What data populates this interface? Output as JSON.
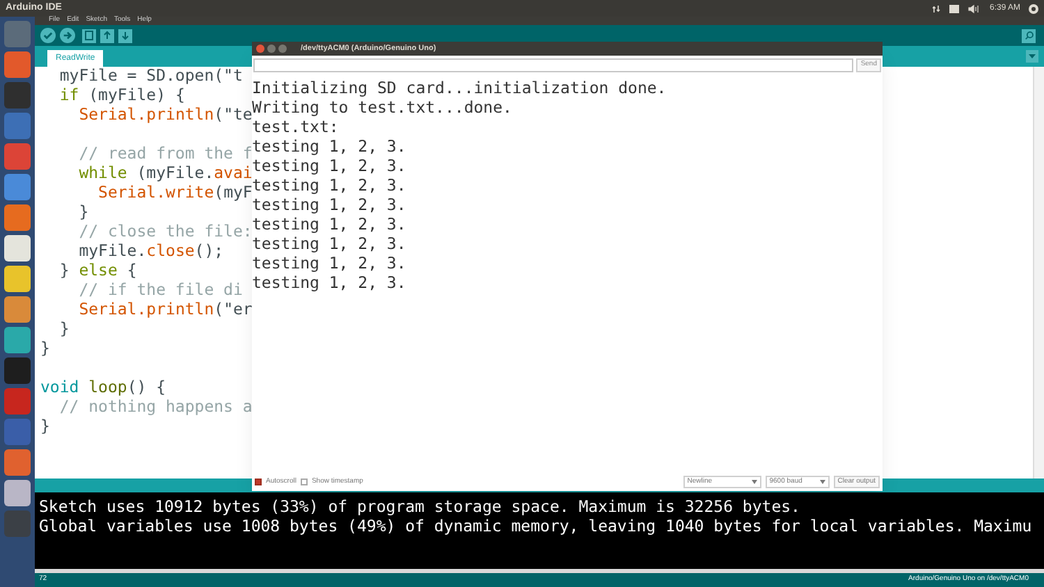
{
  "top_bar": {
    "title": "Arduino IDE",
    "time": "6:39 AM"
  },
  "launcher": {
    "items": [
      {
        "color": "#5b6b7a"
      },
      {
        "color": "#e2592b"
      },
      {
        "color": "#2f2f2f"
      },
      {
        "color": "#3d6fb5"
      },
      {
        "color": "#dc4437"
      },
      {
        "color": "#4a8ad8"
      },
      {
        "color": "#e66b1f"
      },
      {
        "color": "#e4e4dc"
      },
      {
        "color": "#e8c32b"
      },
      {
        "color": "#d98a3a"
      },
      {
        "color": "#2aa9a9"
      },
      {
        "color": "#1e1e1e"
      },
      {
        "color": "#c7261e"
      },
      {
        "color": "#3a5ea8"
      },
      {
        "color": "#e0612f"
      },
      {
        "color": "#b9b6c6"
      },
      {
        "color": "#3b4046"
      }
    ]
  },
  "menu": [
    "File",
    "Edit",
    "Sketch",
    "Tools",
    "Help"
  ],
  "tabs": [
    {
      "label": "ReadWrite",
      "selected": true
    }
  ],
  "editor": {
    "lines": [
      {
        "kind": "code",
        "segments": [
          {
            "text": "  myFile = SD.open(\"t",
            "kind": "plain"
          }
        ]
      },
      {
        "kind": "code",
        "segments": [
          {
            "text": "  if",
            "kind": "keyword"
          },
          {
            "text": " (myFile) {",
            "kind": "plain"
          }
        ]
      },
      {
        "kind": "code",
        "segments": [
          {
            "text": "    Serial",
            "kind": "class"
          },
          {
            "text": ".println",
            "kind": "function"
          },
          {
            "text": "(\"te",
            "kind": "plain"
          }
        ]
      },
      {
        "kind": "blank"
      },
      {
        "kind": "code",
        "segments": [
          {
            "text": "    // read from the f",
            "kind": "comment"
          }
        ]
      },
      {
        "kind": "code",
        "segments": [
          {
            "text": "    while",
            "kind": "keyword"
          },
          {
            "text": " (myFile.",
            "kind": "plain"
          },
          {
            "text": "avai",
            "kind": "function"
          }
        ]
      },
      {
        "kind": "code",
        "segments": [
          {
            "text": "      Serial",
            "kind": "class"
          },
          {
            "text": ".write",
            "kind": "function"
          },
          {
            "text": "(myF",
            "kind": "plain"
          }
        ]
      },
      {
        "kind": "code",
        "segments": [
          {
            "text": "    }",
            "kind": "plain"
          }
        ]
      },
      {
        "kind": "code",
        "segments": [
          {
            "text": "    // close the file:",
            "kind": "comment"
          }
        ]
      },
      {
        "kind": "code",
        "segments": [
          {
            "text": "    myFile.",
            "kind": "plain"
          },
          {
            "text": "close",
            "kind": "function"
          },
          {
            "text": "();",
            "kind": "plain"
          }
        ]
      },
      {
        "kind": "code",
        "segments": [
          {
            "text": "  } ",
            "kind": "plain"
          },
          {
            "text": "else",
            "kind": "keyword"
          },
          {
            "text": " {",
            "kind": "plain"
          }
        ]
      },
      {
        "kind": "code",
        "segments": [
          {
            "text": "    // if the file di",
            "kind": "comment"
          }
        ]
      },
      {
        "kind": "code",
        "segments": [
          {
            "text": "    Serial",
            "kind": "class"
          },
          {
            "text": ".println",
            "kind": "function"
          },
          {
            "text": "(\"er",
            "kind": "plain"
          }
        ]
      },
      {
        "kind": "code",
        "segments": [
          {
            "text": "  }",
            "kind": "plain"
          }
        ]
      },
      {
        "kind": "code",
        "segments": [
          {
            "text": "}",
            "kind": "plain"
          }
        ]
      },
      {
        "kind": "blank"
      },
      {
        "kind": "code",
        "segments": [
          {
            "text": "void",
            "kind": "type"
          },
          {
            "text": " loop",
            "kind": "builtin"
          },
          {
            "text": "() {",
            "kind": "plain"
          }
        ]
      },
      {
        "kind": "code",
        "segments": [
          {
            "text": "  // nothing happens a",
            "kind": "comment"
          }
        ]
      },
      {
        "kind": "code",
        "segments": [
          {
            "text": "}",
            "kind": "plain"
          }
        ]
      }
    ]
  },
  "serial_monitor": {
    "title": "/dev/ttyACM0 (Arduino/Genuino Uno)",
    "send": "Send",
    "output": [
      "Initializing SD card...initialization done.",
      "Writing to test.txt...done.",
      "test.txt:",
      "testing 1, 2, 3.",
      "testing 1, 2, 3.",
      "testing 1, 2, 3.",
      "testing 1, 2, 3.",
      "testing 1, 2, 3.",
      "testing 1, 2, 3.",
      "testing 1, 2, 3.",
      "testing 1, 2, 3."
    ],
    "autoscroll": {
      "label": "Autoscroll",
      "checked": true
    },
    "timestamp": {
      "label": "Show timestamp",
      "checked": false
    },
    "line_ending": "Newline",
    "baud": "9600 baud",
    "clear": "Clear output"
  },
  "console": [
    "Sketch uses 10912 bytes (33%) of program storage space. Maximum is 32256 bytes.",
    "Global variables use 1008 bytes (49%) of dynamic memory, leaving 1040 bytes for local variables. Maximu"
  ],
  "status_bar": {
    "line": "72",
    "board": "Arduino/Genuino Uno on /dev/ttyACM0"
  }
}
